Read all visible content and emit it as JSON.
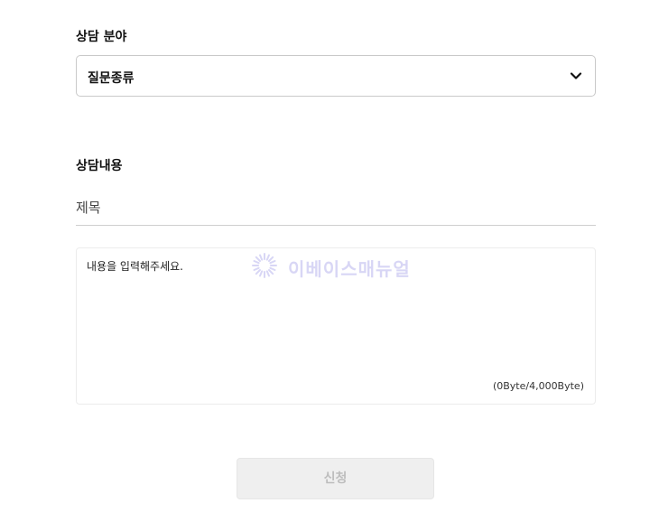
{
  "category": {
    "label": "상담 분야",
    "select_value": "질문종류",
    "icon": "chevron-down-icon"
  },
  "content": {
    "label": "상담내용",
    "title_placeholder": "제목",
    "body_placeholder": "내용을 입력해주세요.",
    "byte_counter": "(0Byte/4,000Byte)"
  },
  "watermark": {
    "text": "이베이스매뉴얼",
    "icon": "sunburst-logo-icon",
    "color": "#b9b6ee"
  },
  "submit": {
    "label": "신청",
    "state": "disabled"
  }
}
